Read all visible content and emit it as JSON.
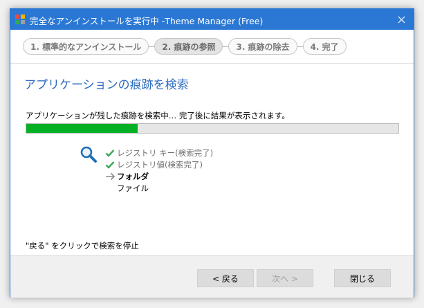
{
  "window": {
    "title": "完全なアンインストールを実行中 -Theme Manager (Free)",
    "close_glyph": "✕"
  },
  "steps": [
    {
      "label": "1. 標準的なアンインストール",
      "active": false
    },
    {
      "label": "2. 痕跡の参照",
      "active": true
    },
    {
      "label": "3. 痕跡の除去",
      "active": false
    },
    {
      "label": "4. 完了",
      "active": false
    }
  ],
  "section_title": "アプリケーションの痕跡を検索",
  "status_text": "アプリケーションが残した痕跡を検索中… 完了後に結果が表示されます。",
  "progress": {
    "percent": 30,
    "color": "#06b025"
  },
  "checklist": [
    {
      "label": "レジストリ キー(検索完了)",
      "state": "done",
      "icon": "check-icon"
    },
    {
      "label": "レジストリ値(検索完了)",
      "state": "done",
      "icon": "check-icon"
    },
    {
      "label": "フォルダ",
      "state": "current",
      "icon": "arrow-right-icon"
    },
    {
      "label": "ファイル",
      "state": "pending",
      "icon": ""
    }
  ],
  "hint": "\"戻る\" をクリックで検索を停止",
  "buttons": {
    "back": "< 戻る",
    "next": "次へ >",
    "close": "閉じる"
  },
  "colors": {
    "titlebar": "#2b78d4",
    "accent_title": "#2d6cc0",
    "check": "#3aa657"
  }
}
